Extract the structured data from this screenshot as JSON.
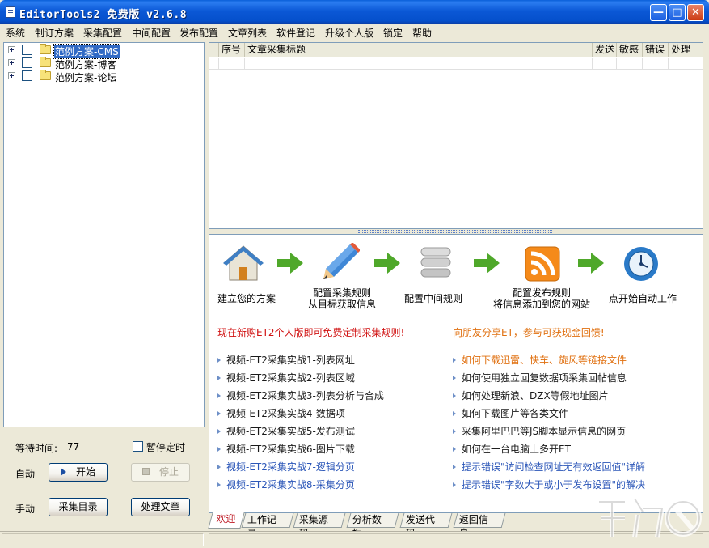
{
  "window": {
    "title": "EditorTools2 免费版 v2.6.8",
    "minimize": "—",
    "maximize": "□",
    "close": "✕"
  },
  "menu": [
    "系统",
    "制订方案",
    "采集配置",
    "中间配置",
    "发布配置",
    "文章列表",
    "软件登记",
    "升级个人版",
    "锁定",
    "帮助"
  ],
  "tree": [
    {
      "label": "范例方案-CMS",
      "selected": true
    },
    {
      "label": "范例方案-博客",
      "selected": false
    },
    {
      "label": "范例方案-论坛",
      "selected": false
    }
  ],
  "controls": {
    "wait_label": "等待时间:",
    "wait_value": "77",
    "pause_label": "暂停定时",
    "auto_label": "自动",
    "start_button": "开始",
    "stop_button": "停止",
    "manual_label": "手动",
    "collect_dir_button": "采集目录",
    "process_button": "处理文章"
  },
  "table": {
    "columns": [
      "序号",
      "文章采集标题",
      "发送",
      "敏感",
      "错误",
      "处理"
    ]
  },
  "steps": [
    {
      "icon": "house-icon",
      "label": "建立您的方案"
    },
    {
      "icon": "pencil-icon",
      "label": "配置采集规则\n从目标获取信息"
    },
    {
      "icon": "database-icon",
      "label": "配置中间规则"
    },
    {
      "icon": "rss-icon",
      "label": "配置发布规则\n将信息添加到您的网站"
    },
    {
      "icon": "clock-icon",
      "label": "点开始自动工作"
    }
  ],
  "promos": {
    "left": "现在新购ET2个人版即可免费定制采集规则!",
    "right": "向朋友分享ET，参与可获现金回馈!"
  },
  "links_left": [
    {
      "text": "视频-ET2采集实战1-列表网址",
      "color": "#1a1a1a"
    },
    {
      "text": "视频-ET2采集实战2-列表区域",
      "color": "#1a1a1a"
    },
    {
      "text": "视频-ET2采集实战3-列表分析与合成",
      "color": "#1a1a1a"
    },
    {
      "text": "视频-ET2采集实战4-数据项",
      "color": "#1a1a1a"
    },
    {
      "text": "视频-ET2采集实战5-发布测试",
      "color": "#1a1a1a"
    },
    {
      "text": "视频-ET2采集实战6-图片下载",
      "color": "#1a1a1a"
    },
    {
      "text": "视频-ET2采集实战7-逻辑分页",
      "color": "#2b56b8"
    },
    {
      "text": "视频-ET2采集实战8-采集分页",
      "color": "#2b56b8"
    }
  ],
  "links_right": [
    {
      "text": "如何下载迅雷、快车、旋风等链接文件",
      "color": "#e07010"
    },
    {
      "text": "如何使用独立回复数据项采集回帖信息",
      "color": "#1a1a1a"
    },
    {
      "text": "如何处理新浪、DZX等假地址图片",
      "color": "#1a1a1a"
    },
    {
      "text": "如何下载图片等各类文件",
      "color": "#1a1a1a"
    },
    {
      "text": "采集阿里巴巴等JS脚本显示信息的网页",
      "color": "#1a1a1a"
    },
    {
      "text": "如何在一台电脑上多开ET",
      "color": "#1a1a1a"
    },
    {
      "text": "提示错误\"访问检查网址无有效返回值\"详解",
      "color": "#2b56b8"
    },
    {
      "text": "提示错误\"字数大于或小于发布设置\"的解决",
      "color": "#2b56b8"
    }
  ],
  "tabs": [
    "欢迎",
    "工作记录",
    "采集源码",
    "分析数据",
    "发送代码",
    "返回信息"
  ],
  "colors": {
    "promo_left": "#d01010",
    "promo_right": "#e07010",
    "active_tab_text": "#c0202a",
    "arrow_green": "#4fa82a"
  }
}
